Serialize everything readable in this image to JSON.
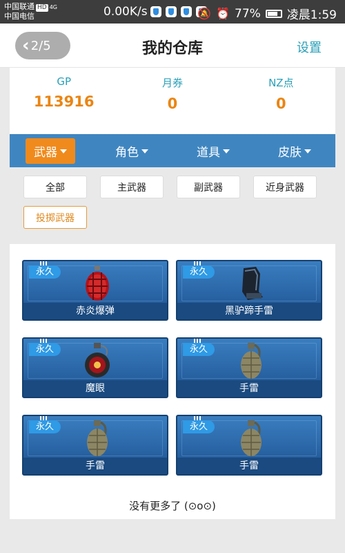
{
  "status_bar": {
    "carrier_1": "中国联通",
    "hd_badge": "HD",
    "signal_label": "4G",
    "carrier_2": "中国电信",
    "net_speed": "0.00K/s",
    "battery": "77%",
    "time": "凌晨1:59"
  },
  "header": {
    "back_count": "2/5",
    "title": "我的仓库",
    "settings": "设置"
  },
  "stats": [
    {
      "label": "GP",
      "value": "113916"
    },
    {
      "label": "月券",
      "value": "0"
    },
    {
      "label": "NZ点",
      "value": "0"
    }
  ],
  "categories": [
    {
      "label": "武器",
      "active": true
    },
    {
      "label": "角色",
      "active": false
    },
    {
      "label": "道具",
      "active": false
    },
    {
      "label": "皮肤",
      "active": false
    }
  ],
  "filters": [
    {
      "label": "全部",
      "active": false
    },
    {
      "label": "主武器",
      "active": false
    },
    {
      "label": "副武器",
      "active": false
    },
    {
      "label": "近身武器",
      "active": false
    },
    {
      "label": "投掷武器",
      "active": true
    }
  ],
  "items": [
    {
      "tag": "永久",
      "name": "赤炎爆弹",
      "icon": "red-bomb-icon"
    },
    {
      "tag": "永久",
      "name": "黑驴蹄手雷",
      "icon": "hoof-grenade-icon"
    },
    {
      "tag": "永久",
      "name": "魔眼",
      "icon": "eye-grenade-icon"
    },
    {
      "tag": "永久",
      "name": "手雷",
      "icon": "grenade-icon"
    },
    {
      "tag": "永久",
      "name": "手雷",
      "icon": "grenade-icon"
    },
    {
      "tag": "永久",
      "name": "手雷",
      "icon": "grenade-icon"
    }
  ],
  "footer": {
    "no_more": "没有更多了 (⊙o⊙)"
  },
  "colors": {
    "accent_teal": "#2aa0b8",
    "value_orange": "#ea8513",
    "tab_blue": "#3f86c1",
    "active_orange": "#f08a1c"
  }
}
